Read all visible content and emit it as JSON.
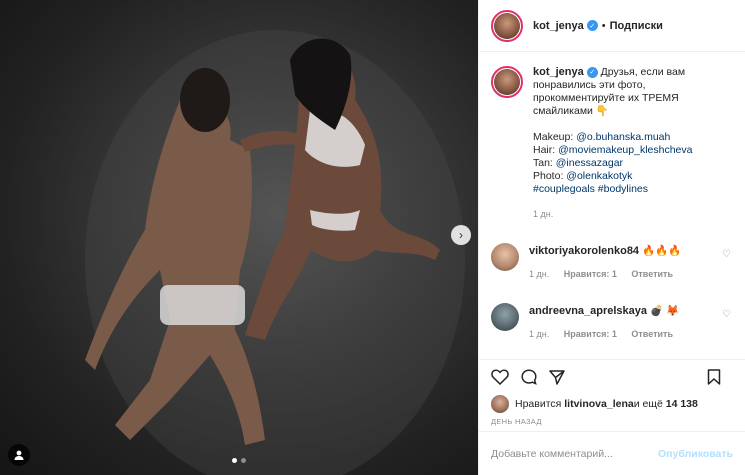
{
  "header": {
    "username": "kot_jenya",
    "separator": "•",
    "follow_label": "Подписки"
  },
  "media": {
    "page_count": 2,
    "active_page": 1
  },
  "caption": {
    "username": "kot_jenya",
    "text": "Друзья, если вам понравились эти фото, прокомментируйте их ТРЕМЯ смайликами 👇",
    "lines": [
      {
        "label": "Makeup: ",
        "link": "@o.buhanska.muah"
      },
      {
        "label": "Hair: ",
        "link": "@moviemakeup_kleshcheva"
      },
      {
        "label": "Tan: ",
        "link": "@inessazagar"
      },
      {
        "label": "Photo: ",
        "link": "@olenkakotyk"
      }
    ],
    "hashtags": "#couplegoals #bodylines",
    "time": "1 дн."
  },
  "comments": [
    {
      "username": "viktoriyakorolenko84",
      "text": "🔥🔥🔥",
      "time": "1 дн.",
      "likes": "Нравится: 1",
      "reply": "Ответить"
    },
    {
      "username": "andreevna_aprelskaya",
      "text": "💣 🦊",
      "time": "1 дн.",
      "likes": "Нравится: 1",
      "reply": "Ответить"
    }
  ],
  "likes": {
    "prefix": "Нравится ",
    "user": "litvinova_lena",
    "suffix": " и ещё ",
    "count": "14 138"
  },
  "date": "ДЕНЬ НАЗАД",
  "add_comment": {
    "placeholder": "Добавьте комментарий...",
    "publish_label": "Опубликовать"
  },
  "colors": {
    "verified": "#3897f0",
    "link": "#00376b",
    "publish_disabled": "#b2dffc"
  }
}
